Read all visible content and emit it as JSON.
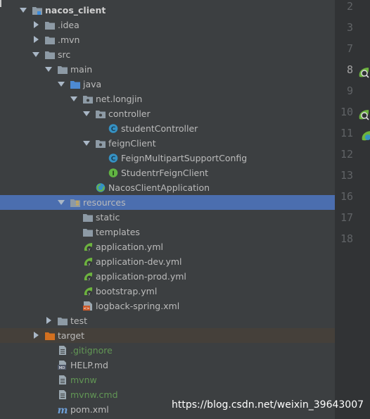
{
  "tree": {
    "items": [
      {
        "label": "nacos_client",
        "icon": "module-folder-icon",
        "arrow": "down",
        "bold": true
      },
      {
        "label": ".idea",
        "icon": "folder-icon",
        "arrow": "right"
      },
      {
        "label": ".mvn",
        "icon": "folder-icon",
        "arrow": "right"
      },
      {
        "label": "src",
        "icon": "folder-icon",
        "arrow": "down"
      },
      {
        "label": "main",
        "icon": "folder-icon",
        "arrow": "down"
      },
      {
        "label": "java",
        "icon": "source-folder-icon",
        "arrow": "down"
      },
      {
        "label": "net.longjin",
        "icon": "package-icon",
        "arrow": "down"
      },
      {
        "label": "controller",
        "icon": "package-icon",
        "arrow": "down"
      },
      {
        "label": "studentController",
        "icon": "class-icon"
      },
      {
        "label": "feignClient",
        "icon": "package-icon",
        "arrow": "down"
      },
      {
        "label": "FeignMultipartSupportConfig",
        "icon": "class-icon"
      },
      {
        "label": "StudentrFeignClient",
        "icon": "interface-icon"
      },
      {
        "label": "NacosClientApplication",
        "icon": "spring-boot-class-icon"
      },
      {
        "label": "resources",
        "icon": "resources-folder-icon",
        "arrow": "down",
        "selected": true
      },
      {
        "label": "static",
        "icon": "folder-icon"
      },
      {
        "label": "templates",
        "icon": "folder-icon"
      },
      {
        "label": "application.yml",
        "icon": "spring-yml-icon"
      },
      {
        "label": "application-dev.yml",
        "icon": "spring-yml-icon"
      },
      {
        "label": "application-prod.yml",
        "icon": "spring-yml-icon"
      },
      {
        "label": "bootstrap.yml",
        "icon": "spring-yml-icon"
      },
      {
        "label": "logback-spring.xml",
        "icon": "xml-file-icon"
      },
      {
        "label": "test",
        "icon": "folder-icon",
        "arrow": "right"
      },
      {
        "label": "target",
        "icon": "excluded-folder-icon",
        "arrow": "right",
        "excluded": true
      },
      {
        "label": ".gitignore",
        "icon": "text-file-icon",
        "green": true
      },
      {
        "label": "HELP.md",
        "icon": "markdown-file-icon"
      },
      {
        "label": "mvnw",
        "icon": "text-file-icon",
        "green": true
      },
      {
        "label": "mvnw.cmd",
        "icon": "text-file-icon",
        "green": true
      },
      {
        "label": "pom.xml",
        "icon": "maven-icon"
      }
    ]
  },
  "gutter": {
    "lines": [
      "2",
      "3",
      "7",
      "8",
      "9",
      "10",
      "11",
      "12",
      "13",
      "16",
      "17",
      "18"
    ],
    "current": "8"
  },
  "watermark": "https://blog.csdn.net/weixin_39643007",
  "colors": {
    "background": "#3c3f41",
    "gutter": "#313335",
    "selection": "#4b6eaf",
    "excluded_row": "#45403a",
    "vcs_new_file": "#629755",
    "spring_green": "#6db33f"
  }
}
